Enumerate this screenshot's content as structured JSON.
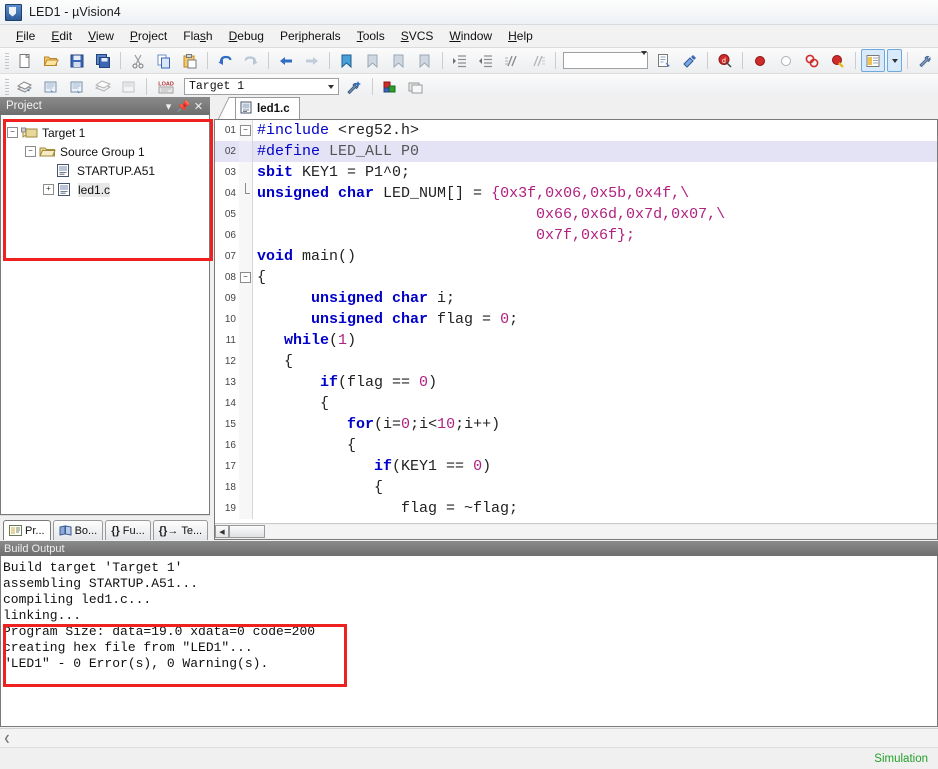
{
  "window": {
    "title": "LED1  - µVision4",
    "app_icon": "uvision-logo-icon"
  },
  "menubar": {
    "items": [
      {
        "label": "File",
        "accel": "F"
      },
      {
        "label": "Edit",
        "accel": "E"
      },
      {
        "label": "View",
        "accel": "V"
      },
      {
        "label": "Project",
        "accel": "P"
      },
      {
        "label": "Flash",
        "accel": "s"
      },
      {
        "label": "Debug",
        "accel": "D"
      },
      {
        "label": "Peripherals",
        "accel": "i"
      },
      {
        "label": "Tools",
        "accel": "T"
      },
      {
        "label": "SVCS",
        "accel": "S"
      },
      {
        "label": "Window",
        "accel": "W"
      },
      {
        "label": "Help",
        "accel": "H"
      }
    ]
  },
  "toolbar_main": {
    "icons": [
      "new-file-icon",
      "open-file-icon",
      "save-icon",
      "save-all-icon",
      "cut-icon",
      "copy-icon",
      "paste-icon",
      "undo-icon",
      "redo-icon",
      "navigate-back-icon",
      "navigate-forward-icon",
      "bookmark-toggle-icon",
      "bookmark-prev-icon",
      "bookmark-next-icon",
      "bookmark-clear-icon",
      "indent-icon",
      "outdent-icon",
      "comment-icon",
      "uncomment-icon"
    ],
    "right_icons": [
      "insert-file-icon",
      "find-in-files-icon",
      "debug-start-icon",
      "breakpoint-icon",
      "breakpoint-disable-icon",
      "breakpoint-clear-all-icon",
      "breakpoint-disable-all-icon",
      "window-layout-icon",
      "window-layout-dropdown-icon",
      "configure-icon"
    ],
    "find_value": "",
    "find_placeholder": ""
  },
  "toolbar_build": {
    "icons": [
      "translate-icon",
      "build-target-icon",
      "rebuild-all-icon",
      "batch-build-icon",
      "stop-build-icon",
      "download-icon"
    ],
    "target_value": "Target 1",
    "after_icons": [
      "target-options-icon",
      "manage-components-icon",
      "manage-multi-project-icon"
    ]
  },
  "project_panel": {
    "caption": "Project",
    "caption_buttons": [
      "dropdown-icon",
      "pin-icon",
      "close-icon"
    ],
    "tree": [
      {
        "level": 0,
        "label": "Target 1",
        "expander": "−",
        "icon": "target-icon",
        "selected": false
      },
      {
        "level": 1,
        "label": "Source Group 1",
        "expander": "−",
        "icon": "folder-icon",
        "selected": false
      },
      {
        "level": 2,
        "label": "STARTUP.A51",
        "expander": "",
        "icon": "source-file-icon",
        "selected": false
      },
      {
        "level": 2,
        "label": "led1.c",
        "expander": "+",
        "icon": "source-file-icon",
        "selected": true
      }
    ],
    "tabs": [
      {
        "label": "Pr...",
        "icon": "project-icon",
        "active": true
      },
      {
        "label": "Bo...",
        "icon": "books-icon",
        "active": false
      },
      {
        "label": "Fu...",
        "icon": "functions-icon",
        "active": false
      },
      {
        "label": "Te...",
        "icon": "templates-icon",
        "active": false
      }
    ]
  },
  "editor": {
    "tab_label": "led1.c",
    "tab_icon": "source-file-icon",
    "lines": [
      {
        "num": "01",
        "fold": "−",
        "highlight": false,
        "tokens": [
          {
            "t": "#include ",
            "c": "pp"
          },
          {
            "t": "<reg52.h>",
            "c": "plain"
          }
        ]
      },
      {
        "num": "02",
        "fold": "",
        "highlight": true,
        "tokens": [
          {
            "t": "#define ",
            "c": "pp"
          },
          {
            "t": "LED_ALL P0",
            "c": "ppid"
          }
        ]
      },
      {
        "num": "03",
        "fold": "",
        "highlight": false,
        "tokens": [
          {
            "t": "sbit ",
            "c": "k"
          },
          {
            "t": "KEY1 = P1^0;",
            "c": "plain"
          }
        ]
      },
      {
        "num": "04",
        "fold": "end",
        "highlight": false,
        "tokens": [
          {
            "t": "unsigned char ",
            "c": "k"
          },
          {
            "t": "LED_NUM[] = ",
            "c": "plain"
          },
          {
            "t": "{0x3f,0x06,0x5b,0x4f,\\",
            "c": "hex"
          }
        ]
      },
      {
        "num": "05",
        "fold": "",
        "highlight": false,
        "tokens": [
          {
            "t": "                               0x66,0x6d,0x7d,0x07,\\",
            "c": "hex"
          }
        ]
      },
      {
        "num": "06",
        "fold": "",
        "highlight": false,
        "tokens": [
          {
            "t": "                               0x7f,0x6f};",
            "c": "hex"
          }
        ]
      },
      {
        "num": "07",
        "fold": "",
        "highlight": false,
        "tokens": [
          {
            "t": "void ",
            "c": "k"
          },
          {
            "t": "main()",
            "c": "plain"
          }
        ]
      },
      {
        "num": "08",
        "fold": "−",
        "highlight": false,
        "tokens": [
          {
            "t": "{",
            "c": "plain"
          }
        ]
      },
      {
        "num": "09",
        "fold": "",
        "highlight": false,
        "tokens": [
          {
            "t": "      ",
            "c": "plain"
          },
          {
            "t": "unsigned char ",
            "c": "k"
          },
          {
            "t": "i;",
            "c": "plain"
          }
        ]
      },
      {
        "num": "10",
        "fold": "",
        "highlight": false,
        "tokens": [
          {
            "t": "      ",
            "c": "plain"
          },
          {
            "t": "unsigned char ",
            "c": "k"
          },
          {
            "t": "flag = ",
            "c": "plain"
          },
          {
            "t": "0",
            "c": "num"
          },
          {
            "t": ";",
            "c": "plain"
          }
        ]
      },
      {
        "num": "11",
        "fold": "",
        "highlight": false,
        "tokens": [
          {
            "t": "   ",
            "c": "plain"
          },
          {
            "t": "while",
            "c": "k"
          },
          {
            "t": "(",
            "c": "plain"
          },
          {
            "t": "1",
            "c": "num"
          },
          {
            "t": ")",
            "c": "plain"
          }
        ]
      },
      {
        "num": "12",
        "fold": "",
        "highlight": false,
        "tokens": [
          {
            "t": "   {",
            "c": "plain"
          }
        ]
      },
      {
        "num": "13",
        "fold": "",
        "highlight": false,
        "tokens": [
          {
            "t": "       ",
            "c": "plain"
          },
          {
            "t": "if",
            "c": "k"
          },
          {
            "t": "(flag == ",
            "c": "plain"
          },
          {
            "t": "0",
            "c": "num"
          },
          {
            "t": ")",
            "c": "plain"
          }
        ]
      },
      {
        "num": "14",
        "fold": "",
        "highlight": false,
        "tokens": [
          {
            "t": "       {",
            "c": "plain"
          }
        ]
      },
      {
        "num": "15",
        "fold": "",
        "highlight": false,
        "tokens": [
          {
            "t": "          ",
            "c": "plain"
          },
          {
            "t": "for",
            "c": "k"
          },
          {
            "t": "(i=",
            "c": "plain"
          },
          {
            "t": "0",
            "c": "num"
          },
          {
            "t": ";i<",
            "c": "plain"
          },
          {
            "t": "10",
            "c": "num"
          },
          {
            "t": ";i++)",
            "c": "plain"
          }
        ]
      },
      {
        "num": "16",
        "fold": "",
        "highlight": false,
        "tokens": [
          {
            "t": "          {",
            "c": "plain"
          }
        ]
      },
      {
        "num": "17",
        "fold": "",
        "highlight": false,
        "tokens": [
          {
            "t": "             ",
            "c": "plain"
          },
          {
            "t": "if",
            "c": "k"
          },
          {
            "t": "(KEY1 == ",
            "c": "plain"
          },
          {
            "t": "0",
            "c": "num"
          },
          {
            "t": ")",
            "c": "plain"
          }
        ]
      },
      {
        "num": "18",
        "fold": "",
        "highlight": false,
        "tokens": [
          {
            "t": "             {",
            "c": "plain"
          }
        ]
      },
      {
        "num": "19",
        "fold": "",
        "highlight": false,
        "tokens": [
          {
            "t": "                flag = ~flag;",
            "c": "plain"
          }
        ]
      }
    ]
  },
  "build_output": {
    "caption": "Build Output",
    "lines": [
      "Build target 'Target 1'",
      "assembling STARTUP.A51...",
      "compiling led1.c...",
      "linking...",
      "Program Size: data=19.0 xdata=0 code=200",
      "creating hex file from \"LED1\"...",
      "\"LED1\" - 0 Error(s), 0 Warning(s)."
    ]
  },
  "statusbar": {
    "simulation_label": "Simulation",
    "simulation_color": "#23a02a"
  },
  "annotations": {
    "highlight_color": "#ef2020",
    "boxes": [
      "project-tree-highlight",
      "build-result-highlight"
    ]
  }
}
